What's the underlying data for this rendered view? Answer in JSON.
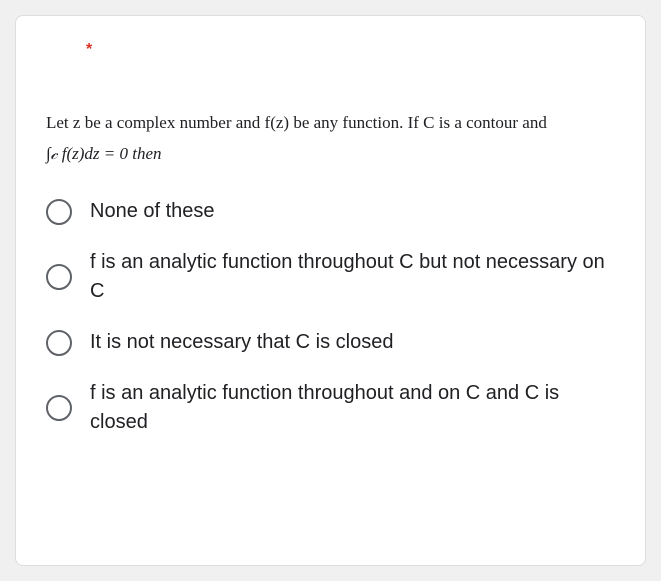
{
  "required_marker": "*",
  "question": {
    "line1": "Let z be a complex number and f(z) be any function. If C is a contour and",
    "line2": "∫𝒸 f(z)dz = 0 then"
  },
  "options": [
    {
      "label": "None of these"
    },
    {
      "label": "f is an analytic function throughout C but not necessary on C"
    },
    {
      "label": "It is not necessary that C is closed"
    },
    {
      "label": "f is an analytic function throughout and on C and C is closed"
    }
  ]
}
